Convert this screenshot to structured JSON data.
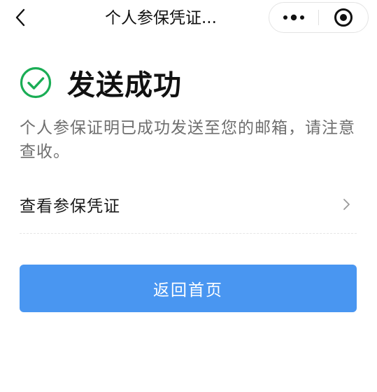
{
  "navbar": {
    "title": "个人参保凭证...",
    "icons": {
      "back": "chevron-left-icon",
      "more": "more-dots-icon",
      "close": "target-close-icon"
    }
  },
  "success": {
    "title": "发送成功",
    "icon": "check-circle-icon",
    "icon_color": "#1aad55"
  },
  "description": "个人参保证明已成功发送至您的邮箱，请注意查收。",
  "list": {
    "view_voucher_label": "查看参保凭证",
    "chevron_icon": "chevron-right-icon"
  },
  "primary_button": {
    "label": "返回首页",
    "color": "#4996f1"
  }
}
